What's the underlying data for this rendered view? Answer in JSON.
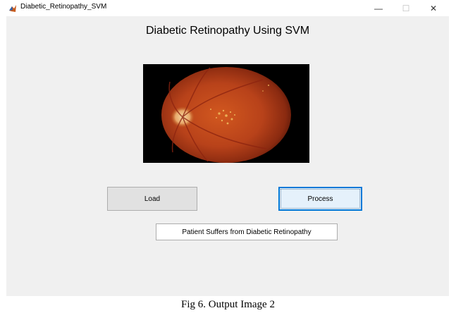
{
  "window": {
    "title": "Diabetic_Retinopathy_SVM",
    "app_icon": "matlab-icon",
    "controls": {
      "minimize_glyph": "—",
      "maximize_glyph": "☐",
      "close_glyph": "✕"
    }
  },
  "main": {
    "heading": "Diabetic Retinopathy Using SVM",
    "image_description_icon": "retina-fundus-image",
    "load_label": "Load",
    "process_label": "Process",
    "result_text": "Patient Suffers from Diabetic Retinopathy"
  },
  "caption": "Fig 6. Output Image 2",
  "colors": {
    "window_bg": "#f0f0f0",
    "focus_border": "#0078d7",
    "focus_bg": "#e5f1fb",
    "retina_orange": "#c0491a"
  }
}
